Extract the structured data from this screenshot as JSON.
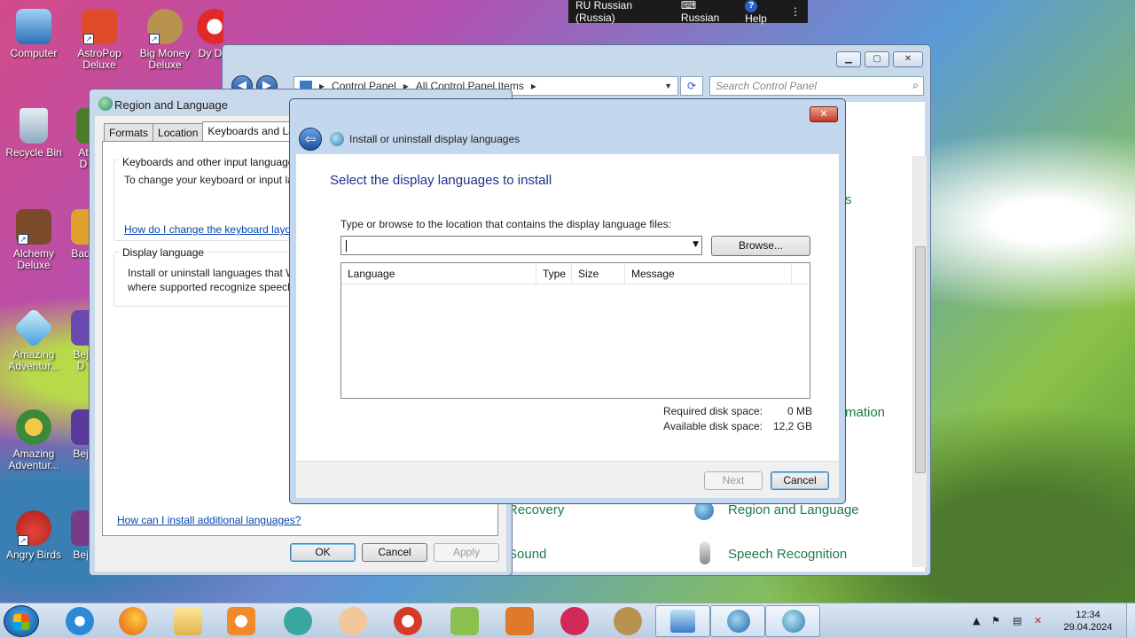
{
  "desktop": {
    "icons": [
      {
        "label": "Computer",
        "color": "#3a7bc8"
      },
      {
        "label": "AstroPop Deluxe",
        "color": "#e04b2a"
      },
      {
        "label": "Big Money Deluxe",
        "color": "#b89350"
      },
      {
        "label": "Dy D",
        "color": "#d8d8d8"
      },
      {
        "label": "Recycle Bin",
        "color": "#9fb6c8"
      },
      {
        "label": "At D",
        "color": "#4a7c2a"
      },
      {
        "label": "Alchemy Deluxe",
        "color": "#7a4a2a"
      },
      {
        "label": "Bad",
        "color": "#e0a030"
      },
      {
        "label": "Amazing Adventur...",
        "color": "#4db0d8"
      },
      {
        "label": "Bej D",
        "color": "#6a4ab0"
      },
      {
        "label": "Amazing Adventur...",
        "color": "#3a8a3a"
      },
      {
        "label": "Bej",
        "color": "#5a3a9a"
      },
      {
        "label": "Angry Birds",
        "color": "#d83a2a"
      },
      {
        "label": "Bej",
        "color": "#7a3a8a"
      }
    ]
  },
  "langbar": {
    "locale": "RU Russian (Russia)",
    "keyboard": "Russian",
    "help": "Help"
  },
  "control_panel": {
    "breadcrumb": [
      "Control Panel",
      "All Control Panel Items"
    ],
    "search_placeholder": "Search Control Panel",
    "items": [
      {
        "label": "s"
      },
      {
        "label": "mation"
      },
      {
        "label": "Recovery"
      },
      {
        "label": "Region and Language"
      },
      {
        "label": "Sound"
      },
      {
        "label": "Speech Recognition"
      }
    ]
  },
  "region_language": {
    "title": "Region and Language",
    "tabs": [
      "Formats",
      "Location",
      "Keyboards and Languages"
    ],
    "keyboards_group": "Keyboards and other input languages",
    "keyboards_text": "To change your keyboard or input language click Change keyboards.",
    "keyboards_link": "How do I change the keyboard layout for the Welcome screen?",
    "display_group": "Display language",
    "display_text_1": "Install or uninstall languages that Windows can use to display text and,",
    "display_text_2": "where supported recognize speech and handwriting.",
    "bottom_link": "How can I install additional languages?",
    "ok": "OK",
    "cancel": "Cancel",
    "apply": "Apply"
  },
  "install_dialog": {
    "title": "Install or uninstall display languages",
    "heading": "Select the display languages to install",
    "path_label": "Type or browse to the location that contains the display language files:",
    "path_value": "",
    "browse": "Browse...",
    "columns": [
      "Language",
      "Type",
      "Size",
      "Message"
    ],
    "required_label": "Required disk space:",
    "required_value": "0 MB",
    "available_label": "Available disk space:",
    "available_value": "12,2 GB",
    "next": "Next",
    "cancel": "Cancel"
  },
  "taskbar": {
    "time": "12:34",
    "date": "29.04.2024"
  }
}
